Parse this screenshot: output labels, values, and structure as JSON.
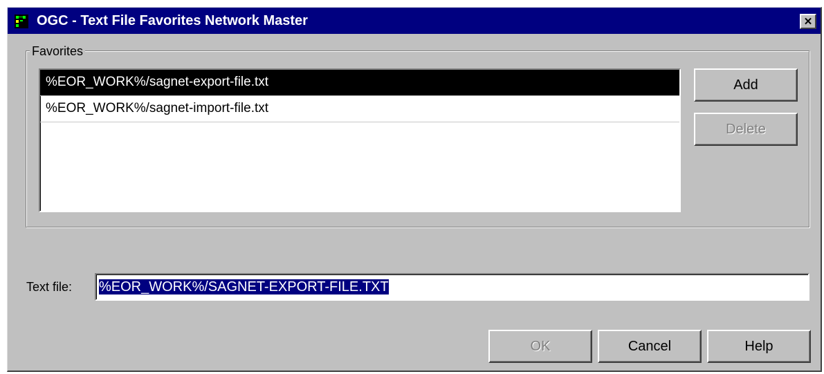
{
  "window": {
    "title": "OGC - Text File Favorites Network Master",
    "close_symbol": "✕"
  },
  "favorites": {
    "label": "Favorites",
    "items": [
      {
        "text": "%EOR_WORK%/sagnet-export-file.txt",
        "selected": true
      },
      {
        "text": "%EOR_WORK%/sagnet-import-file.txt",
        "selected": false
      }
    ],
    "add_label": "Add",
    "delete_label": "Delete"
  },
  "text_file": {
    "label": "Text file:",
    "value": "%EOR_WORK%/SAGNET-EXPORT-FILE.TXT"
  },
  "buttons": {
    "ok_label": "OK",
    "cancel_label": "Cancel",
    "help_label": "Help"
  },
  "colors": {
    "titlebar": "#000080",
    "face": "#c0c0c0",
    "selection": "#000000",
    "text_selection": "#000080"
  },
  "icons": {
    "app": "network-master-icon",
    "close": "close-icon"
  }
}
